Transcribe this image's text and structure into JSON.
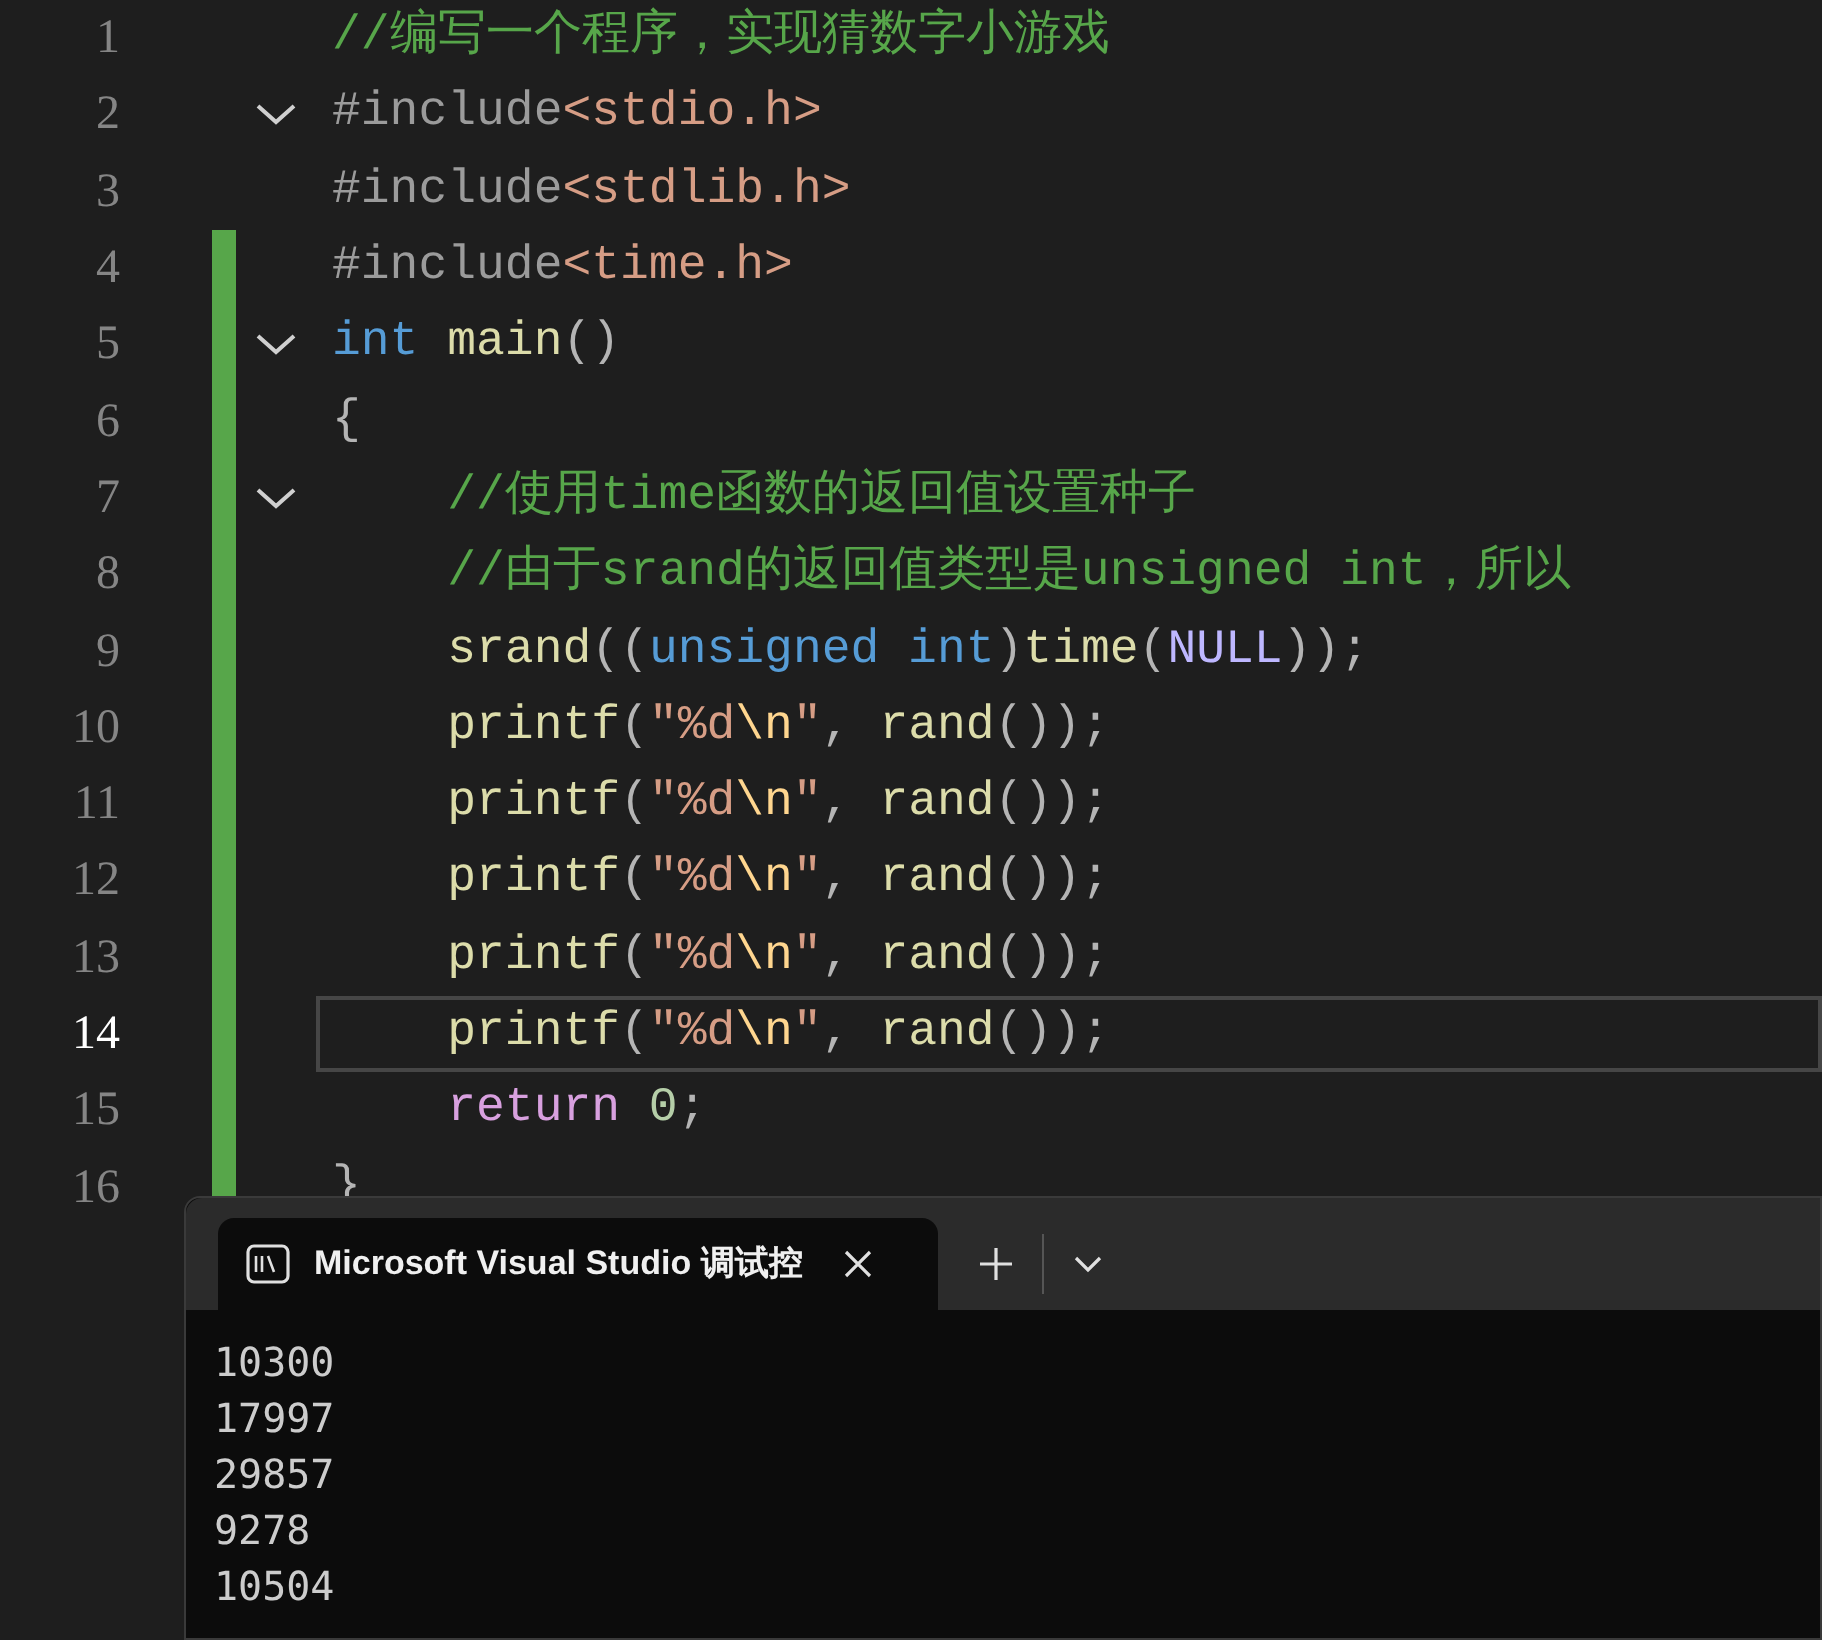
{
  "editor": {
    "lines": [
      {
        "number": "1",
        "current": false,
        "changed": false,
        "expanded": false,
        "tokens": [
          {
            "kind": "comment",
            "text": "//编写一个程序，实现猜数字小游戏"
          }
        ]
      },
      {
        "number": "2",
        "current": false,
        "changed": false,
        "expanded": true,
        "tokens": [
          {
            "kind": "preproc",
            "text": "#include"
          },
          {
            "kind": "string",
            "text": "<stdio.h>"
          }
        ]
      },
      {
        "number": "3",
        "current": false,
        "changed": false,
        "expanded": false,
        "tokens": [
          {
            "kind": "preproc",
            "text": "#include"
          },
          {
            "kind": "string",
            "text": "<stdlib.h>"
          }
        ]
      },
      {
        "number": "4",
        "current": false,
        "changed": true,
        "expanded": false,
        "tokens": [
          {
            "kind": "preproc",
            "text": "#include"
          },
          {
            "kind": "string",
            "text": "<time.h>"
          }
        ]
      },
      {
        "number": "5",
        "current": false,
        "changed": true,
        "expanded": true,
        "tokens": [
          {
            "kind": "keyword",
            "text": "int"
          },
          {
            "kind": "function",
            "text": " main"
          },
          {
            "kind": "punct",
            "text": "()"
          }
        ]
      },
      {
        "number": "6",
        "current": false,
        "changed": true,
        "expanded": false,
        "tokens": [
          {
            "kind": "punct",
            "text": "{"
          }
        ]
      },
      {
        "number": "7",
        "current": false,
        "changed": true,
        "expanded": true,
        "tokens": [
          {
            "kind": "comment",
            "text": "    //使用time函数的返回值设置种子"
          }
        ]
      },
      {
        "number": "8",
        "current": false,
        "changed": true,
        "expanded": false,
        "tokens": [
          {
            "kind": "comment",
            "text": "    //由于srand的返回值类型是unsigned int，所以"
          }
        ]
      },
      {
        "number": "9",
        "current": false,
        "changed": true,
        "expanded": false,
        "tokens": [
          {
            "kind": "function",
            "text": "    srand"
          },
          {
            "kind": "punct",
            "text": "(("
          },
          {
            "kind": "keyword",
            "text": "unsigned int"
          },
          {
            "kind": "punct",
            "text": ")"
          },
          {
            "kind": "function",
            "text": "time"
          },
          {
            "kind": "punct",
            "text": "("
          },
          {
            "kind": "macro",
            "text": "NULL"
          },
          {
            "kind": "punct",
            "text": "));"
          }
        ]
      },
      {
        "number": "10",
        "current": false,
        "changed": true,
        "expanded": false,
        "tokens": [
          {
            "kind": "function",
            "text": "    printf"
          },
          {
            "kind": "punct",
            "text": "("
          },
          {
            "kind": "string",
            "text": "\"%d"
          },
          {
            "kind": "escape",
            "text": "\\n"
          },
          {
            "kind": "string",
            "text": "\""
          },
          {
            "kind": "punct",
            "text": ", "
          },
          {
            "kind": "function",
            "text": "rand"
          },
          {
            "kind": "punct",
            "text": "());"
          }
        ]
      },
      {
        "number": "11",
        "current": false,
        "changed": true,
        "expanded": false,
        "tokens": [
          {
            "kind": "function",
            "text": "    printf"
          },
          {
            "kind": "punct",
            "text": "("
          },
          {
            "kind": "string",
            "text": "\"%d"
          },
          {
            "kind": "escape",
            "text": "\\n"
          },
          {
            "kind": "string",
            "text": "\""
          },
          {
            "kind": "punct",
            "text": ", "
          },
          {
            "kind": "function",
            "text": "rand"
          },
          {
            "kind": "punct",
            "text": "());"
          }
        ]
      },
      {
        "number": "12",
        "current": false,
        "changed": true,
        "expanded": false,
        "tokens": [
          {
            "kind": "function",
            "text": "    printf"
          },
          {
            "kind": "punct",
            "text": "("
          },
          {
            "kind": "string",
            "text": "\"%d"
          },
          {
            "kind": "escape",
            "text": "\\n"
          },
          {
            "kind": "string",
            "text": "\""
          },
          {
            "kind": "punct",
            "text": ", "
          },
          {
            "kind": "function",
            "text": "rand"
          },
          {
            "kind": "punct",
            "text": "());"
          }
        ]
      },
      {
        "number": "13",
        "current": false,
        "changed": true,
        "expanded": false,
        "tokens": [
          {
            "kind": "function",
            "text": "    printf"
          },
          {
            "kind": "punct",
            "text": "("
          },
          {
            "kind": "string",
            "text": "\"%d"
          },
          {
            "kind": "escape",
            "text": "\\n"
          },
          {
            "kind": "string",
            "text": "\""
          },
          {
            "kind": "punct",
            "text": ", "
          },
          {
            "kind": "function",
            "text": "rand"
          },
          {
            "kind": "punct",
            "text": "());"
          }
        ]
      },
      {
        "number": "14",
        "current": true,
        "changed": true,
        "expanded": false,
        "tokens": [
          {
            "kind": "function",
            "text": "    printf"
          },
          {
            "kind": "punct",
            "text": "("
          },
          {
            "kind": "string",
            "text": "\"%d"
          },
          {
            "kind": "escape",
            "text": "\\n"
          },
          {
            "kind": "string",
            "text": "\""
          },
          {
            "kind": "punct",
            "text": ", "
          },
          {
            "kind": "function",
            "text": "rand"
          },
          {
            "kind": "punct",
            "text": "());"
          }
        ]
      },
      {
        "number": "15",
        "current": false,
        "changed": true,
        "expanded": false,
        "tokens": [
          {
            "kind": "control",
            "text": "    return"
          },
          {
            "kind": "number",
            "text": " 0"
          },
          {
            "kind": "punct",
            "text": ";"
          }
        ]
      },
      {
        "number": "16",
        "current": false,
        "changed": true,
        "expanded": false,
        "tokens": [
          {
            "kind": "punct",
            "text": "}"
          }
        ]
      }
    ]
  },
  "console": {
    "tab": {
      "title": "Microsoft Visual Studio 调试控",
      "selected": true
    },
    "output": [
      "10300",
      "17997",
      "29857",
      "9278",
      "10504"
    ]
  }
}
